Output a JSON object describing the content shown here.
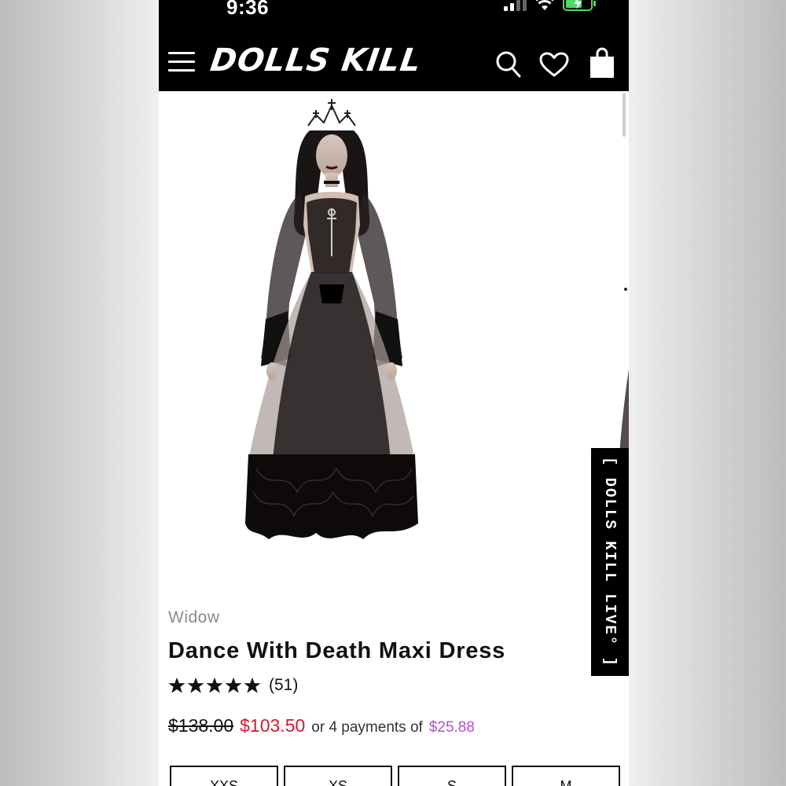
{
  "status_bar": {
    "time": "9:36"
  },
  "header": {
    "logo": "DOLLS KILL",
    "menu_icon": "hamburger-menu-icon",
    "search_icon": "search-icon",
    "wishlist_icon": "heart-icon",
    "cart_icon": "shopping-bag-icon"
  },
  "live_tab": {
    "label": "[ DOLLS KILL LIVE° ]"
  },
  "product": {
    "brand": "Widow",
    "title": "Dance With Death Maxi Dress",
    "rating": {
      "stars": 5,
      "count_label": "(51)"
    },
    "price": {
      "original": "$138.00",
      "sale": "$103.50",
      "installments_text": "or 4 payments of",
      "installment_amount": "$25.88"
    },
    "sizes": [
      "XXS",
      "XS",
      "S",
      "M"
    ]
  },
  "colors": {
    "header_bg": "#000000",
    "sale_price": "#d5192f",
    "installment_amount": "#b24fcf",
    "battery": "#4cd964"
  }
}
